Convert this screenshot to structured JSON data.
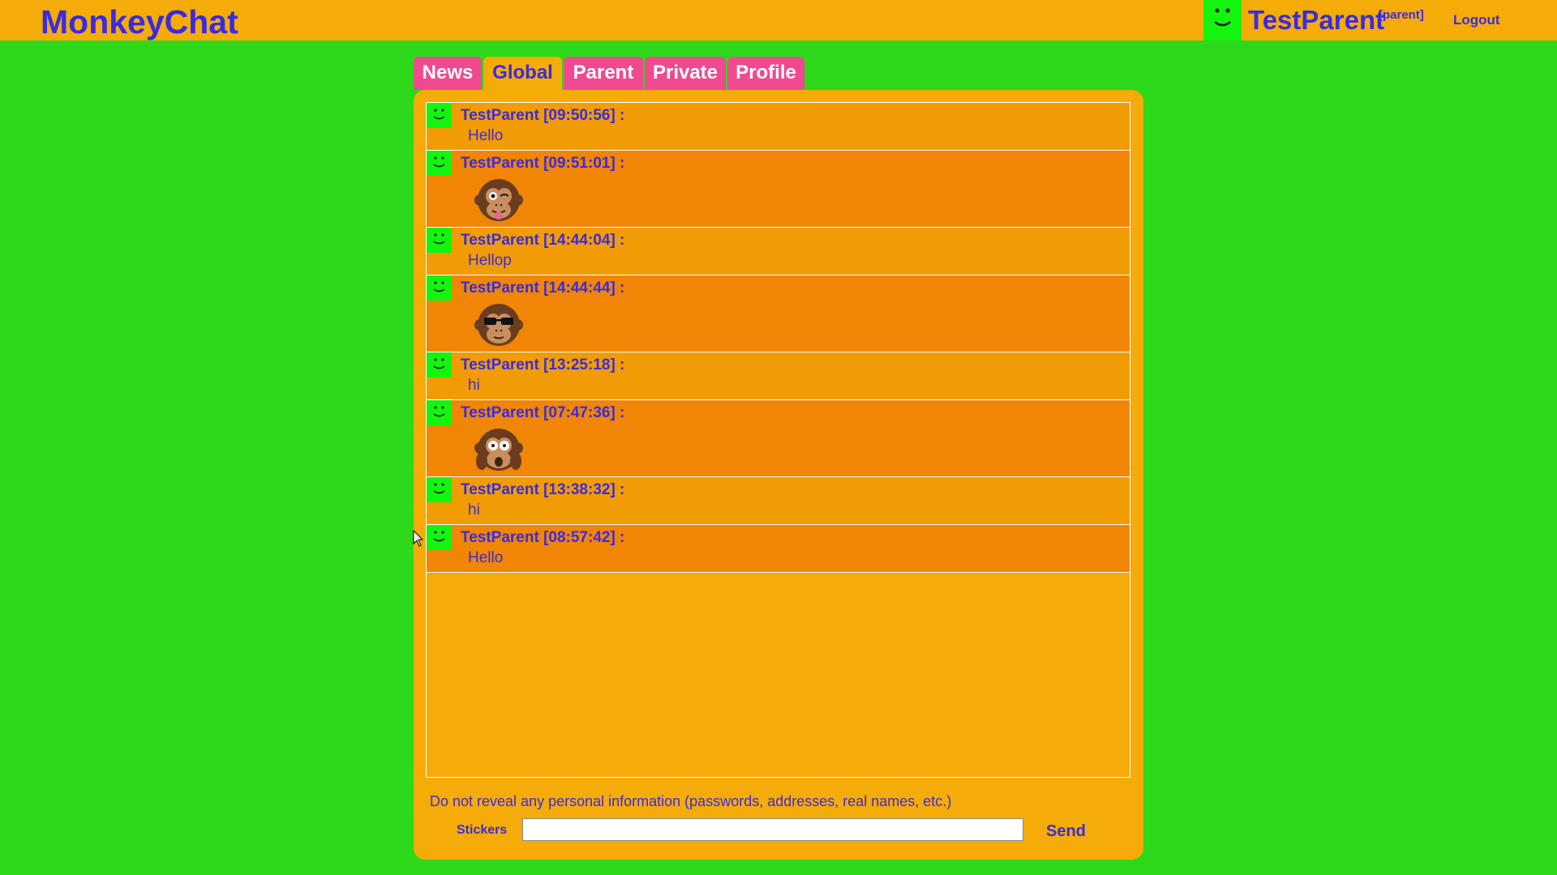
{
  "app": {
    "title": "MonkeyChat"
  },
  "user": {
    "name": "TestParent",
    "role": "[parent]",
    "logout_label": "Logout"
  },
  "tabs": [
    {
      "label": "News",
      "active": false
    },
    {
      "label": "Global",
      "active": true
    },
    {
      "label": "Parent",
      "active": false
    },
    {
      "label": "Private",
      "active": false
    },
    {
      "label": "Profile",
      "active": false
    }
  ],
  "messages": [
    {
      "header": "TestParent [09:50:56] :",
      "text": "Hello"
    },
    {
      "header": "TestParent [09:51:01] :",
      "sticker": "monkey-wink-tongue-sticker"
    },
    {
      "header": "TestParent [14:44:04] :",
      "text": "Hellop"
    },
    {
      "header": "TestParent [14:44:44] :",
      "sticker": "monkey-sunglasses-sticker"
    },
    {
      "header": "TestParent [13:25:18] :",
      "text": "hi"
    },
    {
      "header": "TestParent [07:47:36] :",
      "sticker": "monkey-shocked-sticker"
    },
    {
      "header": "TestParent [13:38:32] :",
      "text": "hi"
    },
    {
      "header": "TestParent [08:57:42] :",
      "text": "Hello"
    }
  ],
  "composer": {
    "notice": "Do not reveal any personal information (passwords, addresses, real names, etc.)",
    "stickers_label": "Stickers",
    "input_value": "",
    "send_label": "Send"
  },
  "colors": {
    "background": "#2ed81a",
    "bar": "#f5ab08",
    "accent_text": "#3a2be0",
    "tab": "#ef4a90",
    "avatar": "#13f50e",
    "row_text": "#f19c04",
    "row_sticker": "#f08506"
  }
}
